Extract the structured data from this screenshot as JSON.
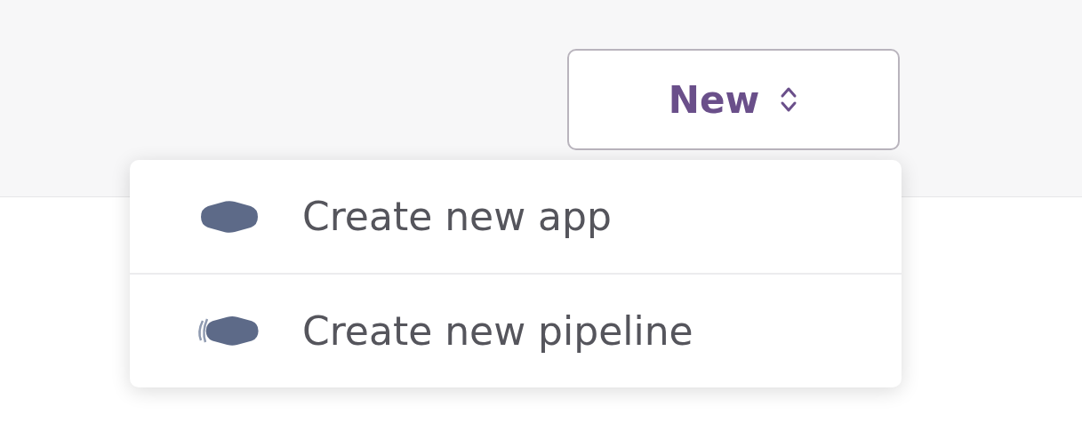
{
  "new_button": {
    "label": "New"
  },
  "menu": {
    "items": [
      {
        "label": "Create new app",
        "kind": "app"
      },
      {
        "label": "Create new pipeline",
        "kind": "pipeline"
      }
    ]
  }
}
